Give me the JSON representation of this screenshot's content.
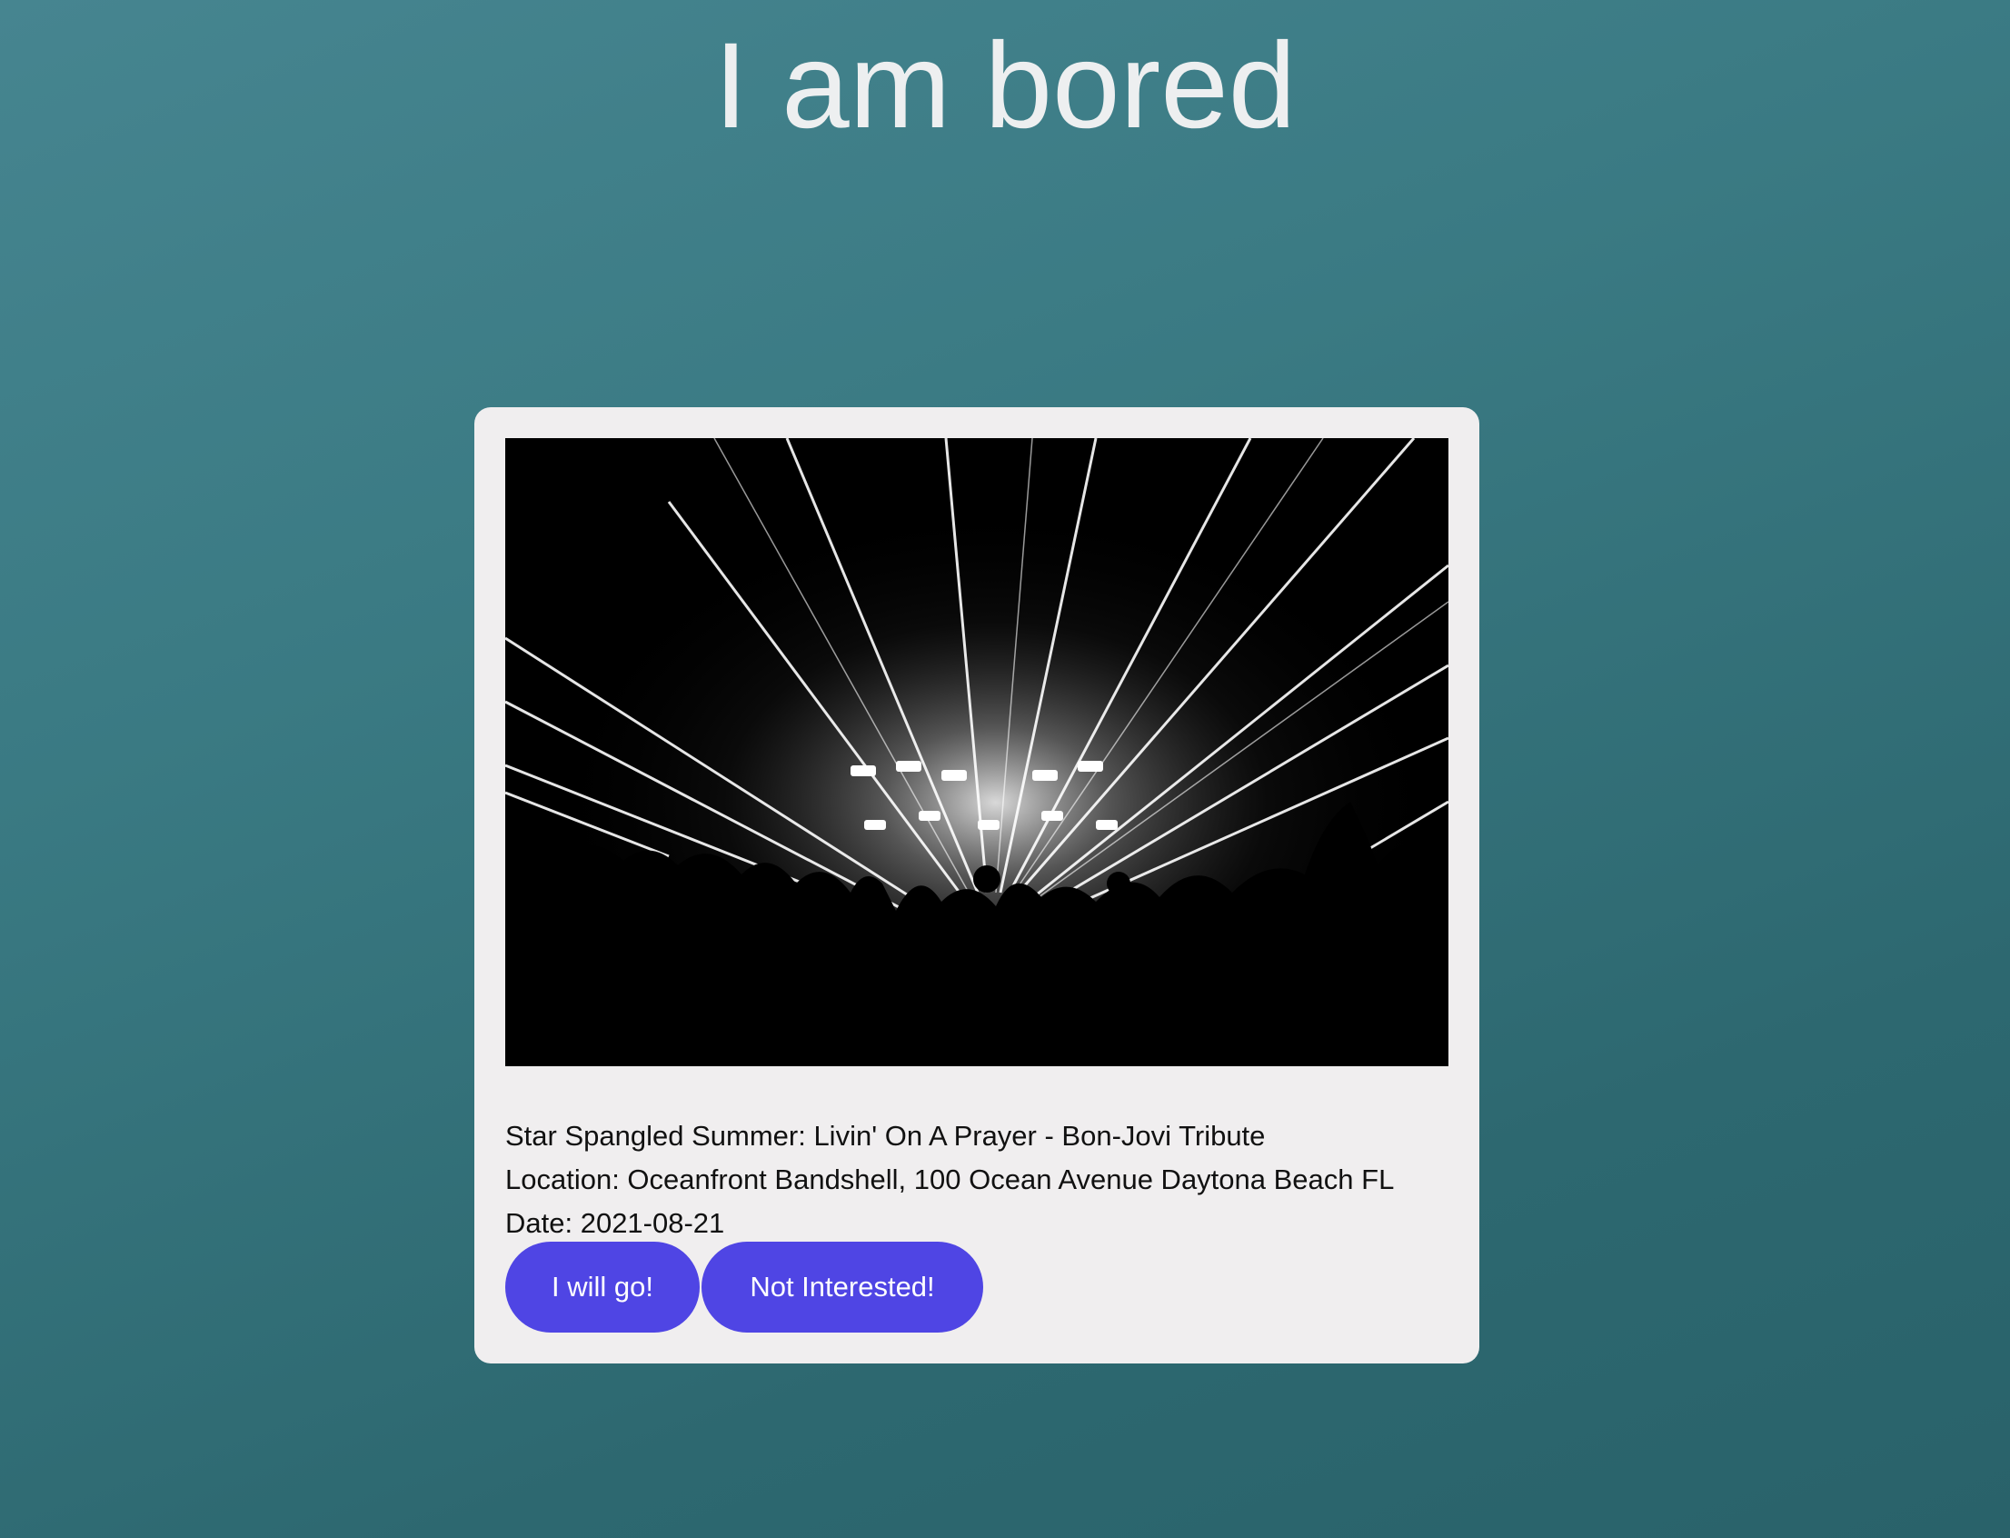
{
  "page": {
    "title": "I am bored",
    "background_colors": [
      "#468590",
      "#29626a"
    ]
  },
  "event": {
    "image_description_icon": "concert-photo",
    "name": "Star Spangled Summer: Livin' On A Prayer - Bon-Jovi Tribute",
    "location": "Location: Oceanfront Bandshell, 100 Ocean Avenue Daytona Beach FL",
    "date": "Date: 2021-08-21"
  },
  "actions": {
    "go_label": "I will go!",
    "not_interested_label": "Not Interested!"
  },
  "colors": {
    "card": "#f0eeef",
    "button": "#4f45e4",
    "button_text": "#ffffff",
    "title_text": "#edeff0"
  }
}
